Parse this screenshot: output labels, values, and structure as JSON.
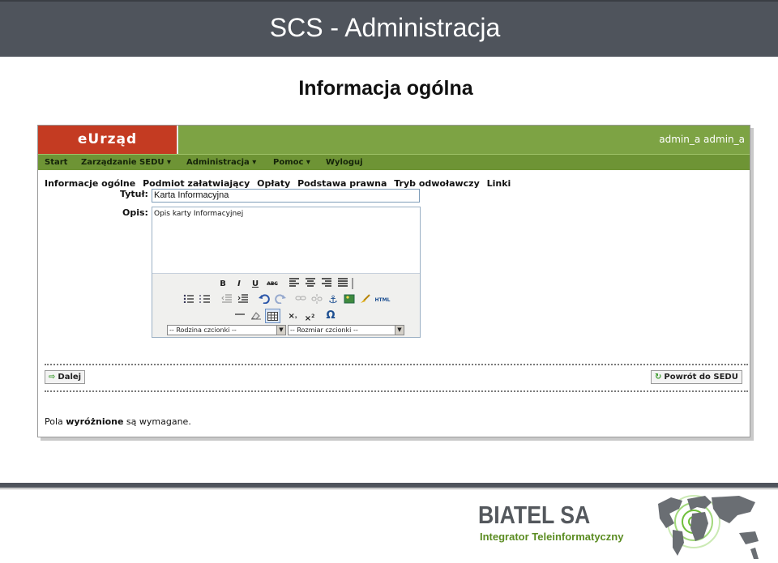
{
  "slide": {
    "title": "SCS - Administracja",
    "subtitle": "Informacja ogólna"
  },
  "app": {
    "brand": "eUrząd",
    "user": "admin_a admin_a",
    "menu": [
      {
        "label": "Start"
      },
      {
        "label": "Zarządzanie SEDU ▾"
      },
      {
        "label": "Administracja ▾"
      },
      {
        "label": "Pomoc ▾"
      },
      {
        "label": "Wyloguj"
      }
    ],
    "tabs": [
      "Informacje ogólne",
      "Podmiot załatwiający",
      "Opłaty",
      "Podstawa prawna",
      "Tryb odwoławczy",
      "Linki"
    ],
    "form": {
      "title_label": "Tytuł:",
      "title_value": "Karta Informacyjna",
      "desc_label": "Opis:",
      "desc_value": "Opis karty Informacyjnej"
    },
    "editor": {
      "toolbar_row1": [
        "B",
        "I",
        "U",
        "ABC"
      ],
      "html_label": "HTML",
      "font_family": "-- Rodzina czcionki --",
      "font_size": "-- Rozmiar czcionki --"
    },
    "buttons": {
      "next": "Dalej",
      "back": "Powrót do SEDU"
    },
    "footnote": {
      "pre": "Pola ",
      "bold": "wyróżnione",
      "post": " są wymagane."
    }
  },
  "footer": {
    "company": "BIATEL SA",
    "tagline": "Integrator Teleinformatyczny"
  }
}
